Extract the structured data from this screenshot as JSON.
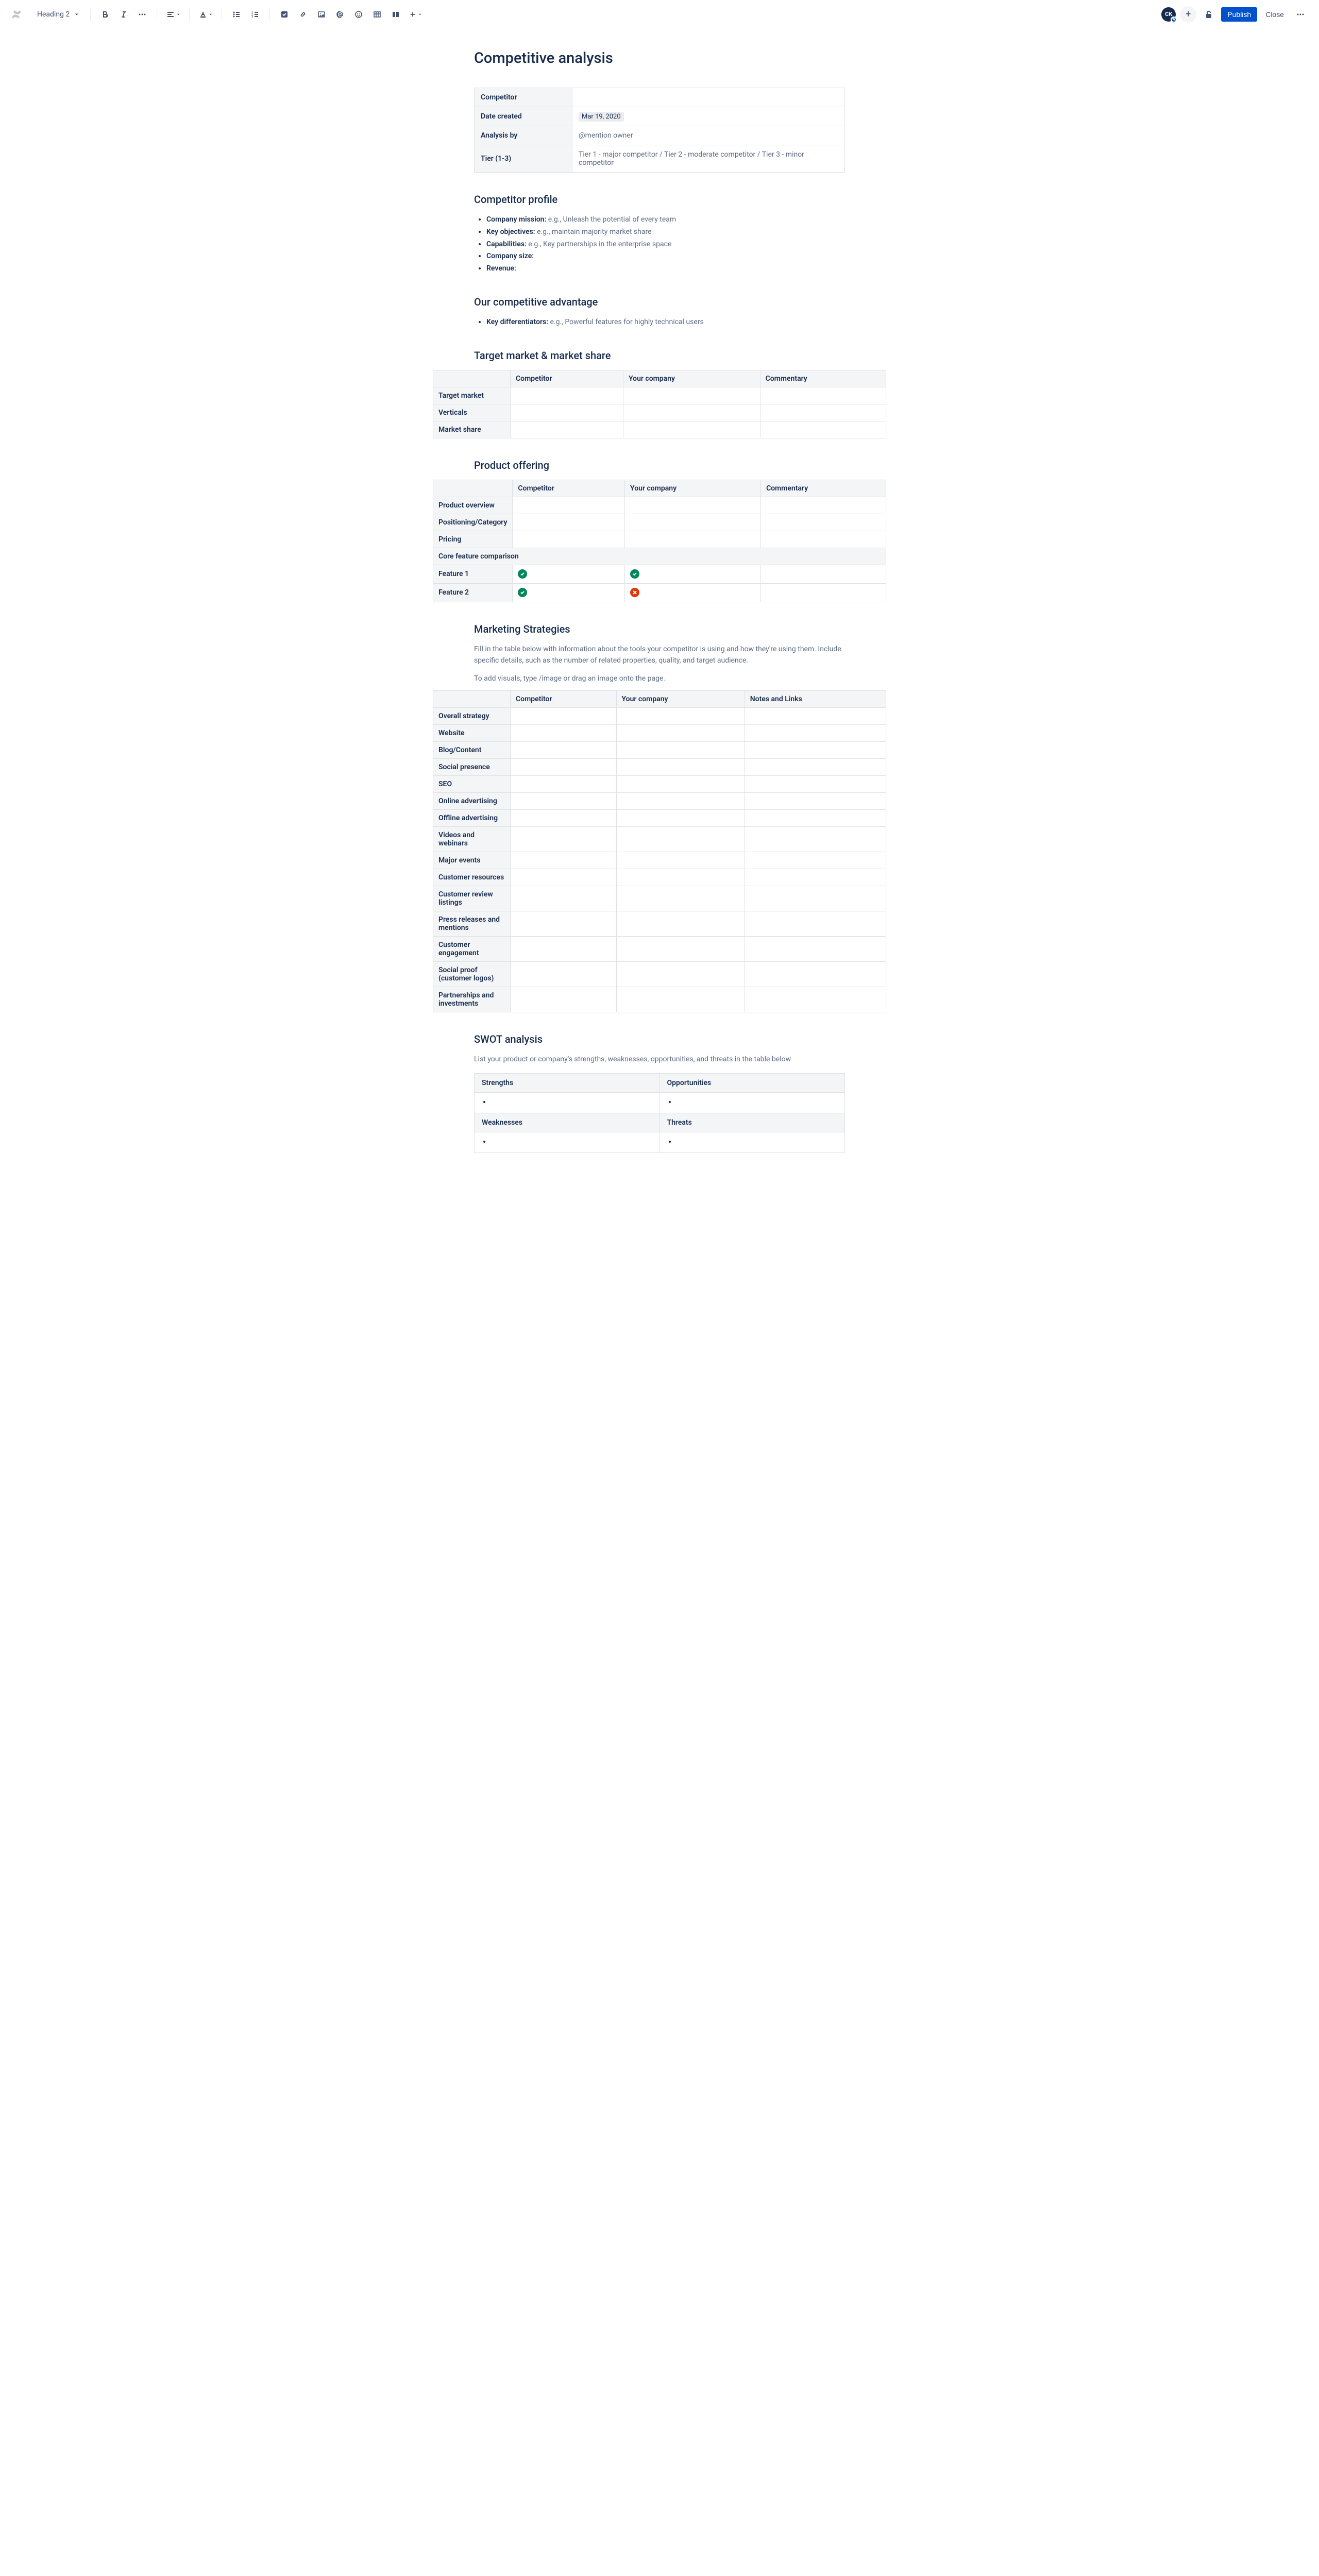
{
  "toolbar": {
    "heading_label": "Heading 2",
    "avatar_initials": "CK",
    "publish_label": "Publish",
    "close_label": "Close"
  },
  "page": {
    "title": "Competitive analysis"
  },
  "info_table": {
    "rows": [
      {
        "label": "Competitor",
        "value": ""
      },
      {
        "label": "Date created",
        "value": "Mar 19, 2020",
        "type": "date"
      },
      {
        "label": "Analysis by",
        "value": "@mention owner",
        "type": "mention"
      },
      {
        "label": "Tier (1-3)",
        "value": "Tier 1 - major competitor / Tier 2 - moderate competitor / Tier 3 - minor competitor",
        "type": "tier"
      }
    ]
  },
  "sections": {
    "competitor_profile": {
      "title": "Competitor profile",
      "bullets": [
        {
          "label": "Company mission:",
          "hint": " e.g., Unleash the potential of every team"
        },
        {
          "label": "Key objectives:",
          "hint": " e.g., maintain majority market share"
        },
        {
          "label": "Capabilities:",
          "hint": " e.g., Key partnerships in the enterprise space"
        },
        {
          "label": "Company size:",
          "hint": ""
        },
        {
          "label": "Revenue:",
          "hint": ""
        }
      ]
    },
    "advantage": {
      "title": "Our competitive advantage",
      "bullets": [
        {
          "label": "Key differentiators:",
          "hint": " e.g., Powerful features for highly technical users"
        }
      ]
    },
    "target_market": {
      "title": "Target market & market share",
      "headers": [
        "",
        "Competitor",
        "Your company",
        "Commentary"
      ],
      "rows": [
        "Target market",
        "Verticals",
        "Market share"
      ]
    },
    "product_offering": {
      "title": "Product offering",
      "headers": [
        "",
        "Competitor",
        "Your company",
        "Commentary"
      ],
      "rows": [
        "Product overview",
        "Positioning/Category",
        "Pricing"
      ],
      "section_row": "Core feature comparison",
      "features": [
        {
          "label": "Feature 1",
          "competitor": "check",
          "yours": "check"
        },
        {
          "label": "Feature 2",
          "competitor": "check",
          "yours": "cross"
        }
      ]
    },
    "marketing": {
      "title": "Marketing Strategies",
      "para1": "Fill in the table below with information about the tools your competitor is using and how they're using them. Include specific details, such as the number of related properties, quality, and target audience.",
      "para2": "To add visuals, type /image or drag an image onto the page.",
      "headers": [
        "",
        "Competitor",
        "Your company",
        "Notes and Links"
      ],
      "rows": [
        "Overall strategy",
        "Website",
        "Blog/Content",
        "Social presence",
        "SEO",
        "Online advertising",
        "Offline advertising",
        "Videos and webinars",
        "Major events",
        "Customer resources",
        "Customer review listings",
        "Press releases and mentions",
        "Customer engagement",
        "Social proof (customer logos)",
        "Partnerships and investments"
      ]
    },
    "swot": {
      "title": "SWOT analysis",
      "para": "List your product or company's strengths, weaknesses, opportunities, and threats in the table below",
      "quads": [
        "Strengths",
        "Opportunities",
        "Weaknesses",
        "Threats"
      ]
    }
  }
}
